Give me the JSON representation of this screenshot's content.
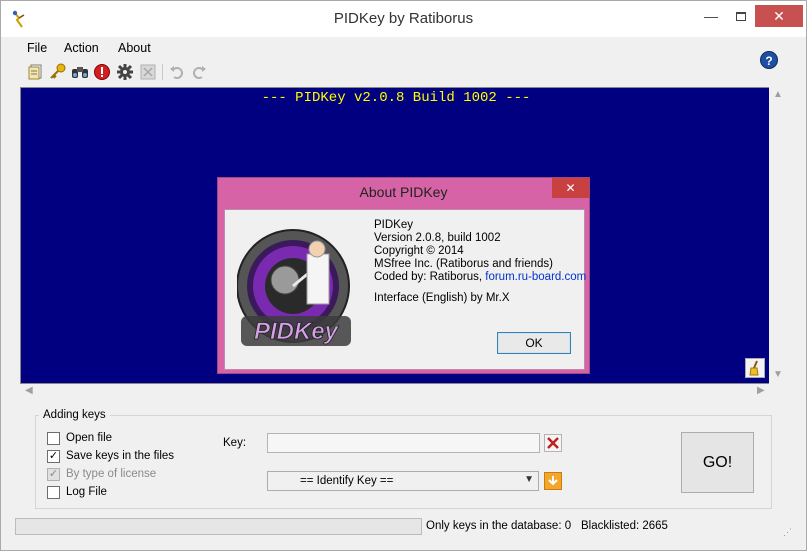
{
  "window": {
    "title": "PIDKey by Ratiborus"
  },
  "menu": {
    "file": "File",
    "action": "Action",
    "about": "About"
  },
  "help": {
    "glyph": "?"
  },
  "console": {
    "header": "--- PIDKey v2.0.8 Build 1002 ---"
  },
  "about_dialog": {
    "title": "About PIDKey",
    "close_glyph": "✕",
    "logo_text": "PIDKey",
    "line1": "PIDKey",
    "line2": "Version 2.0.8, build 1002",
    "line3": "Copyright ©  2014",
    "line4": "MSfree Inc. (Ratiborus and friends)",
    "coded_by": "Coded by: Ratiborus,",
    "link": "forum.ru-board.com",
    "line6": "Interface (English) by Mr.X",
    "ok": "OK"
  },
  "adding_keys": {
    "label": "Adding keys",
    "open_file": "Open file",
    "save_keys": "Save keys in the files",
    "by_type": "By type of license",
    "log_file": "Log File",
    "open_file_checked": false,
    "save_keys_checked": true,
    "by_type_checked": true,
    "log_file_checked": false
  },
  "key": {
    "label": "Key:",
    "value": "",
    "identify": "== Identify Key =="
  },
  "go": "GO!",
  "status": {
    "keys_in_db": "Only keys in the database: 0",
    "blacklisted": "Blacklisted: 2665"
  },
  "colors": {
    "console_bg": "#000080",
    "console_text": "#ffff00",
    "dialog_frame": "#d663a6",
    "close_red": "#c75050"
  }
}
